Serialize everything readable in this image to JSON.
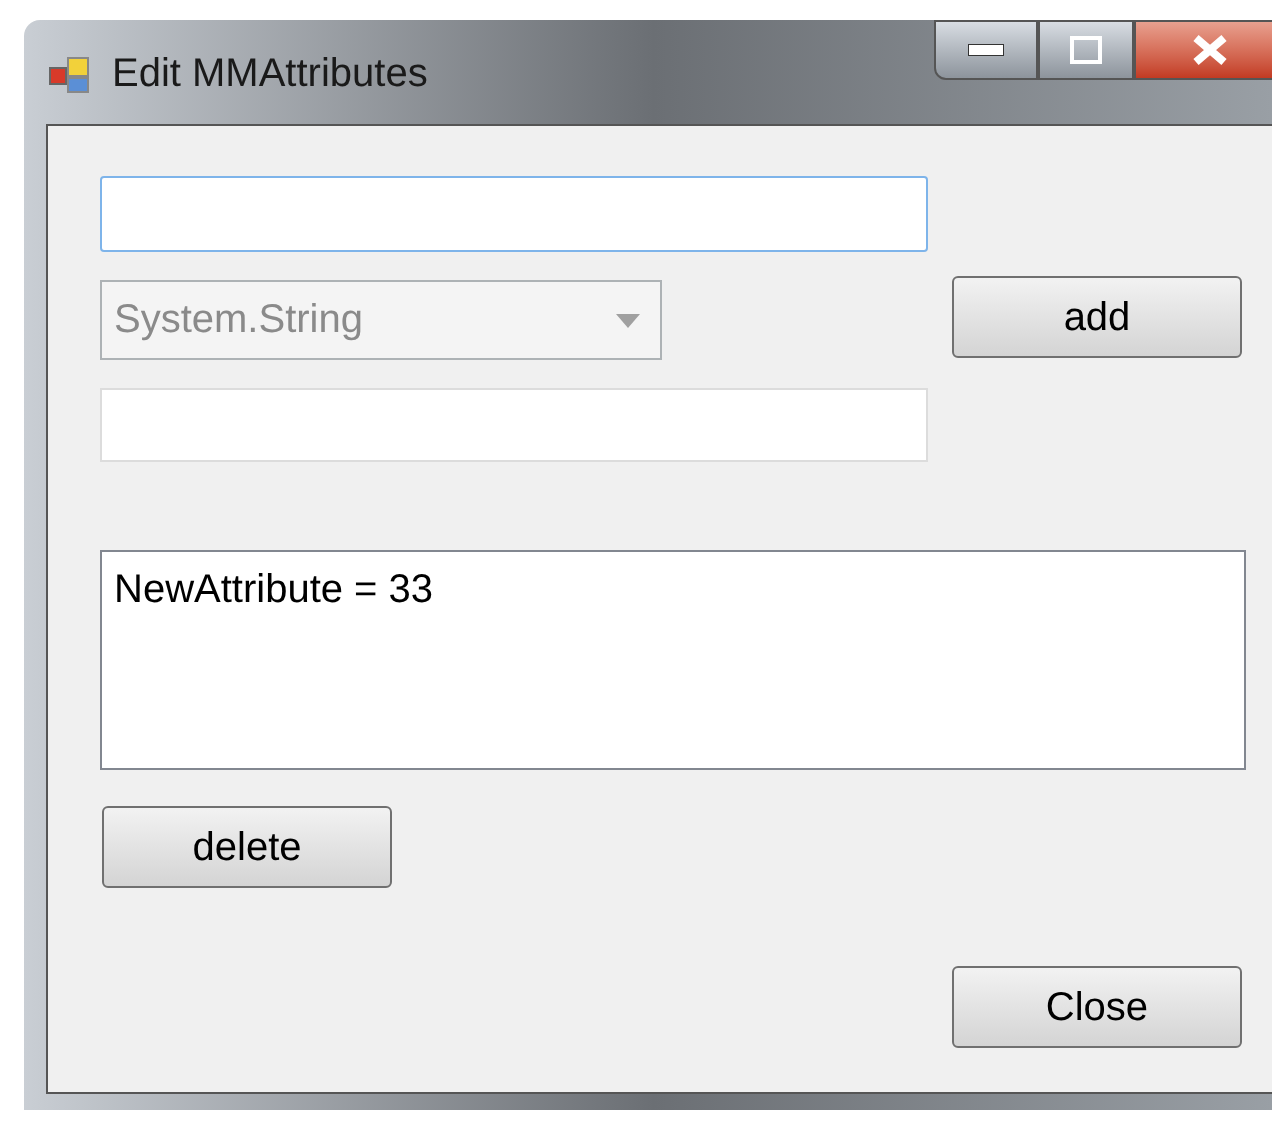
{
  "window": {
    "title": "Edit MMAttributes"
  },
  "type_combo": {
    "value": "System.String",
    "disabled": true
  },
  "attributes_list": {
    "items": [
      {
        "text": "NewAttribute = 33",
        "selected": false
      }
    ]
  },
  "buttons": {
    "add": "add",
    "delete": "delete",
    "close": "Close"
  }
}
